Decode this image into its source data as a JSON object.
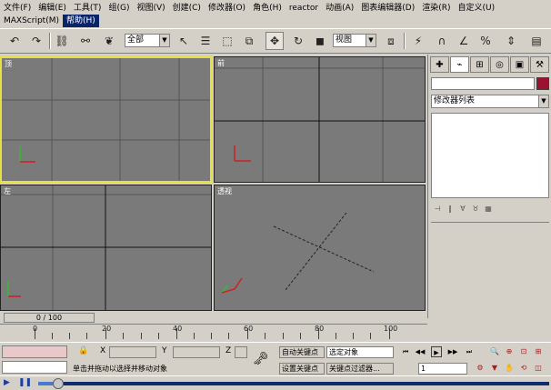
{
  "menus": {
    "row1": [
      "文件(F)",
      "编辑(E)",
      "工具(T)",
      "组(G)",
      "视图(V)",
      "创建(C)",
      "修改器(O)",
      "角色(H)",
      "reactor",
      "动画(A)",
      "图表编辑器(D)",
      "渲染(R)",
      "自定义(U)"
    ],
    "row2": [
      "MAXScript(M)",
      "帮助(H)"
    ],
    "active": "帮助(H)"
  },
  "toolbar": {
    "selection_filter": "全部",
    "ref_coord": "视图"
  },
  "viewports": {
    "top": "顶",
    "front": "前",
    "left": "左",
    "perspective": "透视"
  },
  "command_panel": {
    "modifier_list": "修改器列表"
  },
  "timeline": {
    "slider_label": "0 / 100",
    "ticks": [
      "0",
      "20",
      "40",
      "60",
      "80",
      "100"
    ]
  },
  "status": {
    "coord_x": "X",
    "coord_y": "Y",
    "coord_z": "Z",
    "auto_key": "自动关键点",
    "selected_obj": "选定对象",
    "set_key": "设置关键点",
    "key_filters": "关键点过滤器...",
    "prompt": "单击并拖动以选择并移动对象",
    "frame": "1"
  },
  "colors": {
    "viewport_bg": "#7a7a7a",
    "active_border": "#e8e040",
    "menu_active": "#0a246a",
    "swatch": "#9c1030"
  }
}
